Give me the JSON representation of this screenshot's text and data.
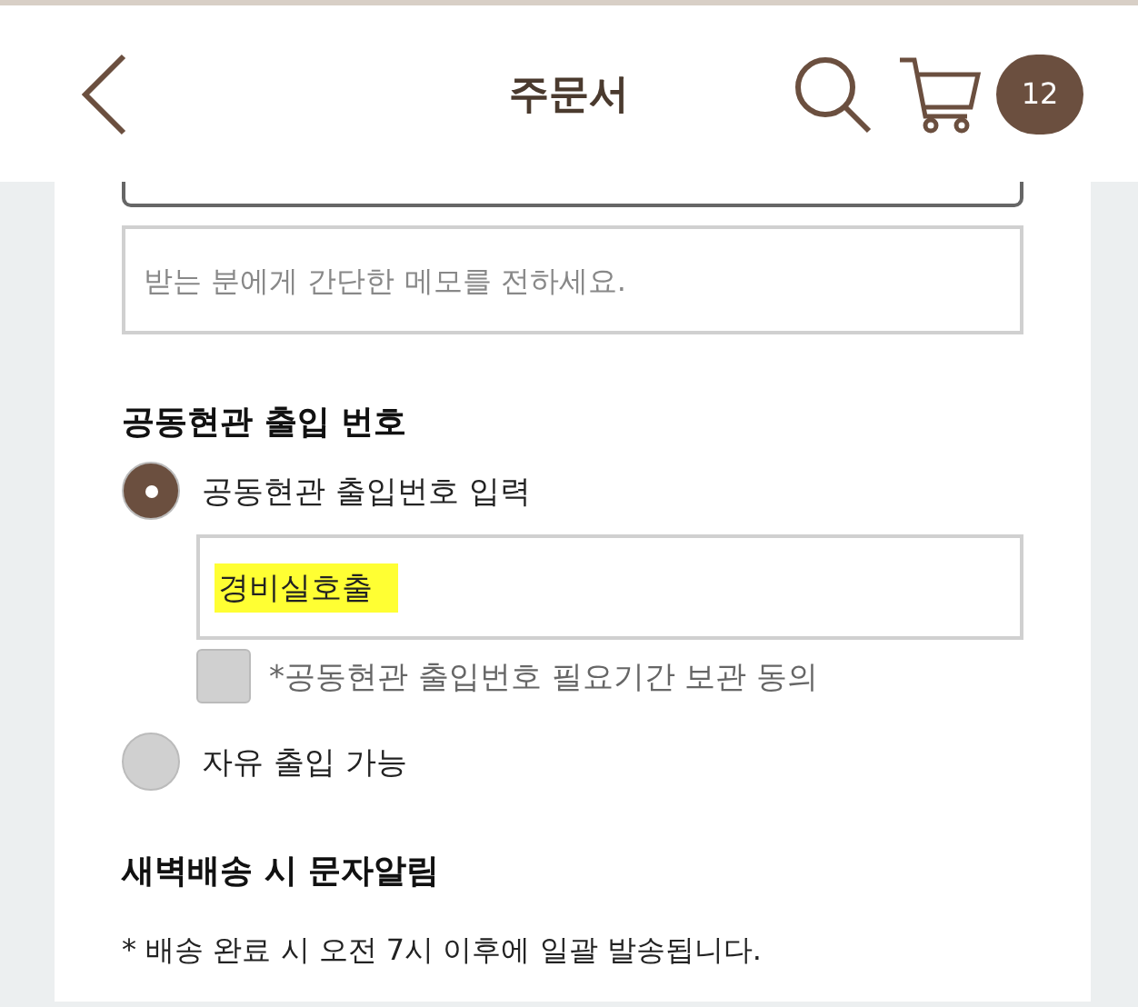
{
  "header": {
    "title": "주문서",
    "cart_count": "12"
  },
  "memo": {
    "placeholder": "받는 분에게 간단한 메모를 전하세요."
  },
  "entrance": {
    "title": "공동현관 출입 번호",
    "options": [
      {
        "label": "공동현관 출입번호 입력",
        "selected": true
      },
      {
        "label": "자유 출입 가능",
        "selected": false
      }
    ],
    "code": {
      "value": "경비실호출",
      "highlighted": true
    },
    "consent": {
      "label": "*공동현관 출입번호 필요기간 보관 동의",
      "checked": false
    }
  },
  "sms": {
    "title": "새벽배송 시 문자알림",
    "note": "* 배송 완료 시 오전 7시 이후에 일괄 발송됩니다."
  }
}
